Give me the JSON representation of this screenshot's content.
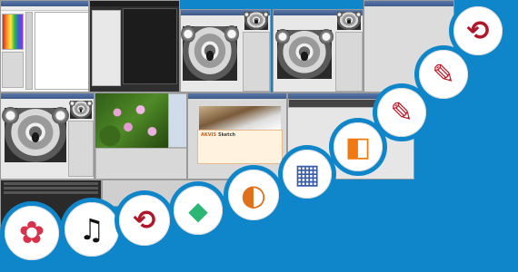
{
  "background_color": "#0e86c9",
  "screenshots": [
    {
      "name": "paint-app",
      "title": ""
    },
    {
      "name": "image-processing-tool",
      "title": ""
    },
    {
      "name": "koala-editor-main",
      "title": ""
    },
    {
      "name": "koala-editor-secondary",
      "title": ""
    },
    {
      "name": "koala-editor-left",
      "title": ""
    },
    {
      "name": "lotus-viewer",
      "title": ""
    },
    {
      "name": "akvis-sketch",
      "title": "AKVIS Sketch"
    },
    {
      "name": "image-list-dark",
      "title": ""
    }
  ],
  "icons": [
    {
      "name": "flower-app-icon",
      "glyph": "✿",
      "color": "#d8324a"
    },
    {
      "name": "music-notes-icon",
      "glyph": "♫",
      "color": "#111111"
    },
    {
      "name": "recycle-clip-icon",
      "glyph": "⟲",
      "color": "#b0182a"
    },
    {
      "name": "green-logo-icon",
      "glyph": "◆",
      "color": "#2bb673"
    },
    {
      "name": "camera-aperture-icon",
      "glyph": "◐",
      "color": "#e0711c"
    },
    {
      "name": "calendar-icon",
      "glyph": "▦",
      "color": "#3a5ca8"
    },
    {
      "name": "orange-blue-logo-icon",
      "glyph": "◧",
      "color": "#f07a10"
    },
    {
      "name": "red-document-icon-1",
      "glyph": "✎",
      "color": "#c01828"
    },
    {
      "name": "red-document-icon-2",
      "glyph": "✎",
      "color": "#c01828"
    },
    {
      "name": "recycle-clip-icon-large",
      "glyph": "⟲",
      "color": "#b0182a"
    }
  ],
  "labels": {
    "akvis_title": "AKVIS",
    "akvis_subtitle": "Sketch"
  }
}
